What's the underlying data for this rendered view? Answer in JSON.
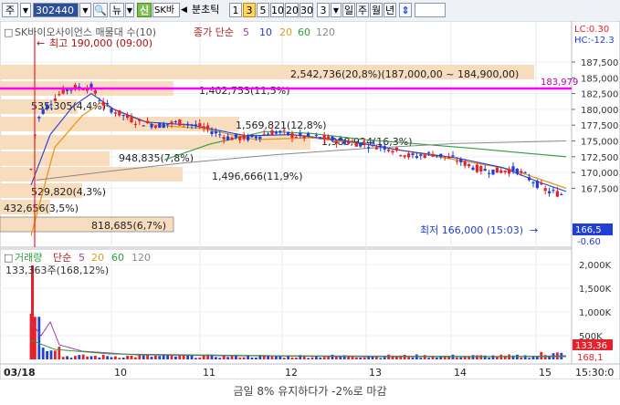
{
  "toolbar": {
    "market_label": "주",
    "stock_code": "302440",
    "news_label": "뉴",
    "credit_label": "신",
    "stock_name": "SK바",
    "period_label": "분초틱",
    "periods": [
      "1",
      "3",
      "5",
      "10",
      "20",
      "30"
    ],
    "selected_period": "3",
    "unit_value": "3",
    "unit_tabs": [
      "일",
      "주",
      "월",
      "년"
    ]
  },
  "price_panel": {
    "title": "SK바이오사이언스 매물대 수(10)",
    "ma_label": "종가 단순",
    "ma_periods": [
      "5",
      "10",
      "20",
      "60",
      "120"
    ],
    "right_top_labels": [
      "LC:0.30",
      "HC:-12.3"
    ],
    "y_ticks": [
      "187,500",
      "185,000",
      "182,500",
      "180,000",
      "177,500",
      "175,000",
      "172,500",
      "170,000",
      "167,500"
    ],
    "current_price": "166,5",
    "change_pct": "-0.60",
    "high_note": "최고 190,000 (09:00)",
    "low_note": "최저 166,000 (15:03)",
    "magenta_level": "183,979",
    "volume_profile": [
      "2,542,736(20,8%)(187,000,00 ~ 184,900,00)",
      "1,402,753(11,5%)",
      "535,305(4,4%)",
      "1,569,821(12,8%)",
      "1,988,924(16,3%)",
      "948,835(7,8%)",
      "1,496,666(11,9%)",
      "529,820(4,3%)",
      "432,656(3,5%)",
      "818,685(6,7%)"
    ]
  },
  "volume_panel": {
    "title": "거래량",
    "ma_label": "단순",
    "ma_periods": [
      "5",
      "20",
      "60",
      "120"
    ],
    "max_note": "133,363주(168,12%)",
    "y_ticks": [
      "2,000K",
      "1,500K",
      "1,000K",
      "500K"
    ],
    "current_volume": "133,36",
    "volume_pct": "168,1"
  },
  "x_axis": {
    "labels": [
      "03/18",
      "10",
      "11",
      "12",
      "13",
      "14",
      "15",
      "15:30:0"
    ]
  },
  "colors": {
    "up": "#e8202a",
    "down": "#1f3fd6",
    "ma5": "#9b3fa8",
    "ma10": "#1f3fd6",
    "ma20": "#e39a1d",
    "ma60": "#2e9e3a",
    "ma120": "#8a8a8a",
    "magenta": "#ff00ff",
    "profile": "#f7dcbd"
  },
  "caption": "금일 8% 유지하다가 -2%로 마감"
}
